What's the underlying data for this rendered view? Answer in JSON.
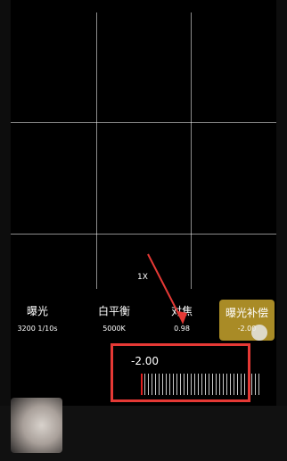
{
  "camera": {
    "zoom_label": "1X",
    "settings": [
      {
        "name": "曝光",
        "value": "3200 1/10s"
      },
      {
        "name": "白平衡",
        "value": "5000K"
      },
      {
        "name": "对焦",
        "value": "0.98"
      },
      {
        "name": "曝光补偿",
        "value": "-2.00"
      }
    ],
    "exposure_comp": {
      "value_label": "-2.00",
      "level_fraction": 0.0
    }
  },
  "colors": {
    "accent_active": "#a98b26",
    "annotation_red": "#e53935",
    "slider_indicator": "#e02020"
  },
  "icons": {
    "annotation_arrow": "red-arrow-icon"
  }
}
